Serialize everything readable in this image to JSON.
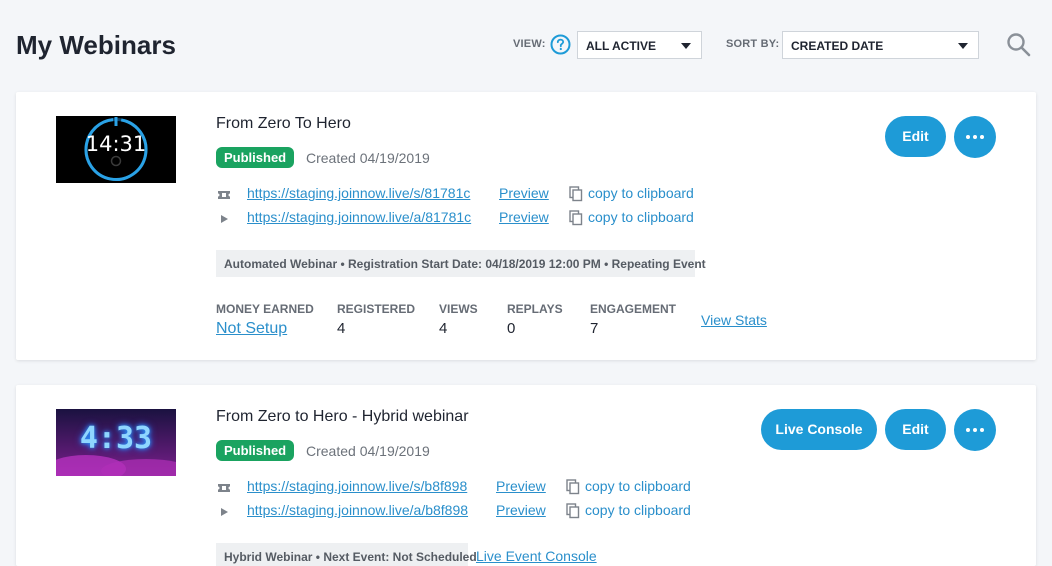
{
  "header": {
    "title": "My Webinars",
    "view_label": "VIEW:",
    "view_value": "ALL ACTIVE",
    "sort_label": "SORT BY:",
    "sort_value": "CREATED DATE"
  },
  "webinars": [
    {
      "title": "From Zero To Hero",
      "thumbnail_text": "14:31",
      "status": "Published",
      "created": "Created 04/19/2019",
      "reg_url": "https://staging.joinnow.live/s/81781c",
      "att_url": "https://staging.joinnow.live/a/81781c",
      "preview_label": "Preview",
      "copy_label": "copy to clipboard",
      "info": "Automated Webinar • Registration Start Date: 04/18/2019 12:00 PM • Repeating Event",
      "edit_label": "Edit",
      "stats": {
        "money_label": "MONEY EARNED",
        "money_value": "Not Setup",
        "registered_label": "REGISTERED",
        "registered_value": "4",
        "views_label": "VIEWS",
        "views_value": "4",
        "replays_label": "REPLAYS",
        "replays_value": "0",
        "engagement_label": "ENGAGEMENT",
        "engagement_value": "7",
        "view_stats_label": "View Stats"
      }
    },
    {
      "title": "From Zero to Hero - Hybrid webinar",
      "thumbnail_text": "4:33",
      "status": "Published",
      "created": "Created 04/19/2019",
      "reg_url": "https://staging.joinnow.live/s/b8f898",
      "att_url": "https://staging.joinnow.live/a/b8f898",
      "preview_label": "Preview",
      "copy_label": "copy to clipboard",
      "info": "Hybrid Webinar • Next Event: Not Scheduled",
      "event_console_label": "Live Event Console",
      "live_console_label": "Live Console",
      "edit_label": "Edit"
    }
  ],
  "colors": {
    "accent": "#1e9bd7",
    "link": "#2a8fcb",
    "published": "#1aa360",
    "background": "#f4f6f9"
  },
  "icons": [
    "help-icon",
    "chevron-down-icon",
    "search-icon",
    "ticket-icon",
    "play-icon",
    "copy-icon",
    "more-icon"
  ]
}
